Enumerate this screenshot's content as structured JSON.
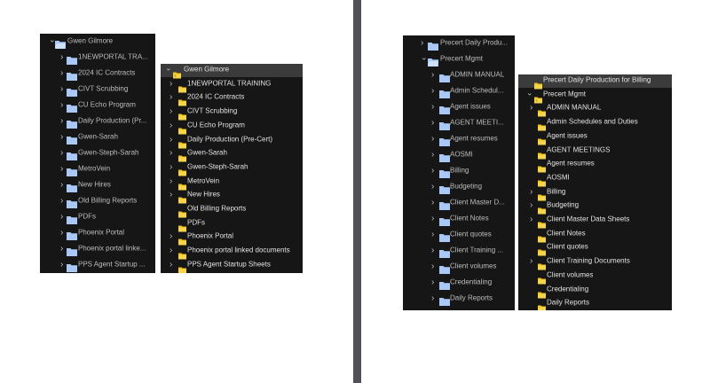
{
  "panels": [
    {
      "style": "blue",
      "items": [
        {
          "label": "Gwen Gilmore",
          "depth": 0,
          "chevron": "down"
        },
        {
          "label": "1NEWPORTAL TRA...",
          "depth": 1,
          "chevron": "right"
        },
        {
          "label": "2024 IC Contracts",
          "depth": 1,
          "chevron": "right"
        },
        {
          "label": "CIVT Scrubbing",
          "depth": 1,
          "chevron": "right"
        },
        {
          "label": "CU Echo Program",
          "depth": 1,
          "chevron": "right"
        },
        {
          "label": "Daily Production (Pr...",
          "depth": 1,
          "chevron": "right"
        },
        {
          "label": "Gwen-Sarah",
          "depth": 1,
          "chevron": "right"
        },
        {
          "label": "Gwen-Steph-Sarah",
          "depth": 1,
          "chevron": "right"
        },
        {
          "label": "MetroVein",
          "depth": 1,
          "chevron": "right"
        },
        {
          "label": "New Hires",
          "depth": 1,
          "chevron": "right"
        },
        {
          "label": "Old Billing Reports",
          "depth": 1,
          "chevron": "right"
        },
        {
          "label": "PDFs",
          "depth": 1,
          "chevron": "right"
        },
        {
          "label": "Phoenix Portal",
          "depth": 1,
          "chevron": "right"
        },
        {
          "label": "Phoenix portal linke...",
          "depth": 1,
          "chevron": "right"
        },
        {
          "label": "PPS Agent Startup ...",
          "depth": 1,
          "chevron": "right"
        }
      ]
    },
    {
      "style": "dark",
      "items": [
        {
          "label": "Gwen Gilmore",
          "depth": 0,
          "chevron": "down",
          "selected": true
        },
        {
          "label": "1NEWPORTAL TRAINING",
          "depth": 1,
          "chevron": "right"
        },
        {
          "label": "2024 IC Contracts",
          "depth": 1,
          "chevron": "right"
        },
        {
          "label": "CIVT Scrubbing",
          "depth": 1,
          "chevron": "right"
        },
        {
          "label": "CU Echo Program",
          "depth": 1,
          "chevron": "right"
        },
        {
          "label": "Daily Production (Pre-Cert)",
          "depth": 1,
          "chevron": "right"
        },
        {
          "label": "Gwen-Sarah",
          "depth": 1,
          "chevron": "right"
        },
        {
          "label": "Gwen-Steph-Sarah",
          "depth": 1,
          "chevron": "right"
        },
        {
          "label": "MetroVein",
          "depth": 1,
          "chevron": "right"
        },
        {
          "label": "New Hires",
          "depth": 1,
          "chevron": "right"
        },
        {
          "label": "Old Billing Reports",
          "depth": 1,
          "chevron": "none"
        },
        {
          "label": "PDFs",
          "depth": 1,
          "chevron": "none"
        },
        {
          "label": "Phoenix Portal",
          "depth": 1,
          "chevron": "right"
        },
        {
          "label": "Phoenix portal linked documents",
          "depth": 1,
          "chevron": "right"
        },
        {
          "label": "PPS Agent Startup Sheets",
          "depth": 1,
          "chevron": "right"
        }
      ]
    },
    {
      "style": "blue",
      "items": [
        {
          "label": "Precert Daily Produ...",
          "depth": 0,
          "chevron": "right"
        },
        {
          "label": "Precert Mgmt",
          "depth": 0,
          "chevron": "down"
        },
        {
          "label": "ADMIN MANUAL",
          "depth": 1,
          "chevron": "right"
        },
        {
          "label": "Admin Schedul...",
          "depth": 1,
          "chevron": "right"
        },
        {
          "label": "Agent issues",
          "depth": 1,
          "chevron": "right"
        },
        {
          "label": "AGENT MEETI...",
          "depth": 1,
          "chevron": "right"
        },
        {
          "label": "Agent resumes",
          "depth": 1,
          "chevron": "right"
        },
        {
          "label": "AOSMI",
          "depth": 1,
          "chevron": "right"
        },
        {
          "label": "Billing",
          "depth": 1,
          "chevron": "right"
        },
        {
          "label": "Budgeting",
          "depth": 1,
          "chevron": "right"
        },
        {
          "label": "Client Master D...",
          "depth": 1,
          "chevron": "right"
        },
        {
          "label": "Client Notes",
          "depth": 1,
          "chevron": "right"
        },
        {
          "label": "Client quotes",
          "depth": 1,
          "chevron": "right"
        },
        {
          "label": "Client Training ...",
          "depth": 1,
          "chevron": "right"
        },
        {
          "label": "Client volumes",
          "depth": 1,
          "chevron": "right"
        },
        {
          "label": "Credentialing",
          "depth": 1,
          "chevron": "right"
        },
        {
          "label": "Daily Reports",
          "depth": 1,
          "chevron": "right"
        }
      ]
    },
    {
      "style": "dark",
      "items": [
        {
          "label": "Precert Daily Production for Billing",
          "depth": 0,
          "chevron": "none",
          "selected": true
        },
        {
          "label": "Precert Mgmt",
          "depth": 0,
          "chevron": "down"
        },
        {
          "label": "ADMIN MANUAL",
          "depth": 1,
          "chevron": "right"
        },
        {
          "label": "Admin Schedules and Duties",
          "depth": 1,
          "chevron": "none"
        },
        {
          "label": "Agent issues",
          "depth": 1,
          "chevron": "none"
        },
        {
          "label": "AGENT MEETINGS",
          "depth": 1,
          "chevron": "none"
        },
        {
          "label": "Agent resumes",
          "depth": 1,
          "chevron": "none"
        },
        {
          "label": "AOSMI",
          "depth": 1,
          "chevron": "none"
        },
        {
          "label": "Billing",
          "depth": 1,
          "chevron": "right"
        },
        {
          "label": "Budgeting",
          "depth": 1,
          "chevron": "right"
        },
        {
          "label": "Client Master Data Sheets",
          "depth": 1,
          "chevron": "right"
        },
        {
          "label": "Client Notes",
          "depth": 1,
          "chevron": "none"
        },
        {
          "label": "Client quotes",
          "depth": 1,
          "chevron": "none"
        },
        {
          "label": "Client Training Documents",
          "depth": 1,
          "chevron": "right"
        },
        {
          "label": "Client volumes",
          "depth": 1,
          "chevron": "none"
        },
        {
          "label": "Credentialing",
          "depth": 1,
          "chevron": "none"
        },
        {
          "label": "Daily Reports",
          "depth": 1,
          "chevron": "none"
        }
      ]
    }
  ],
  "colors": {
    "blue_folder": "#a9c8f5",
    "yellow_folder": "#f2c318",
    "selection": "#3b3b3b"
  }
}
